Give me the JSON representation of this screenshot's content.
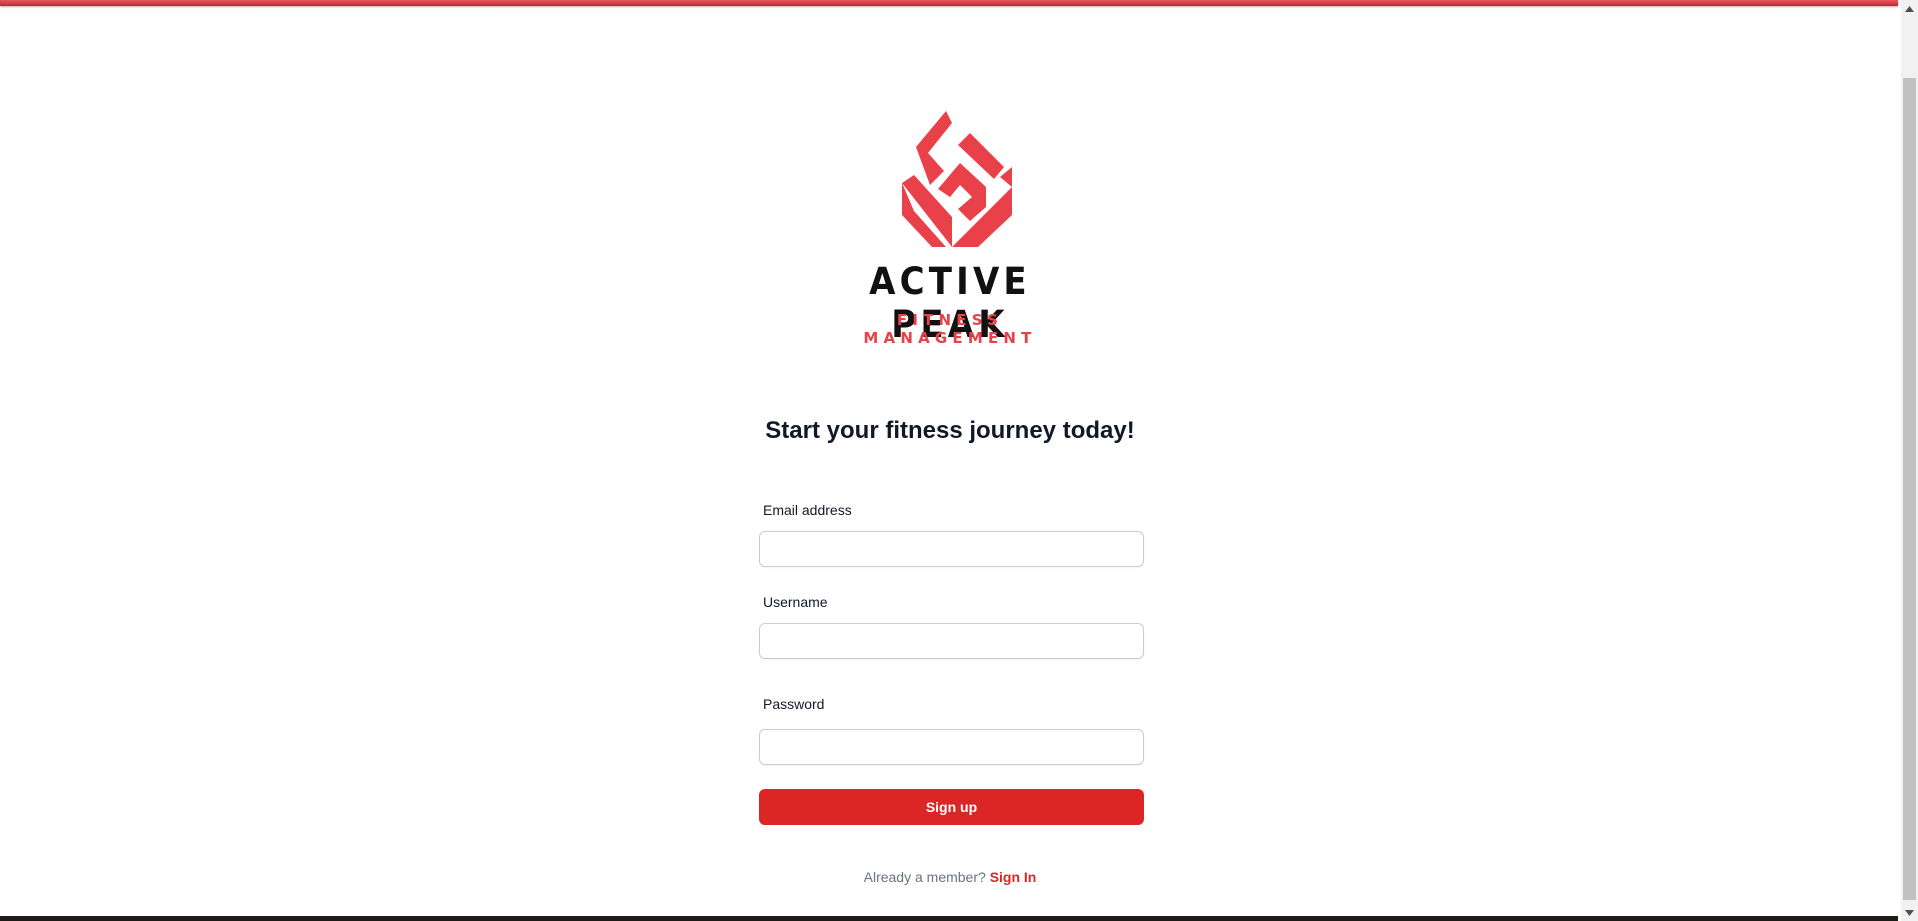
{
  "brand": {
    "name": "ACTIVE PEAK",
    "tagline": "FITNESS MANAGEMENT",
    "accent_color": "#e8414a"
  },
  "heading": "Start your fitness journey today!",
  "form": {
    "email": {
      "label": "Email address",
      "value": "",
      "placeholder": ""
    },
    "username": {
      "label": "Username",
      "value": "",
      "placeholder": ""
    },
    "password": {
      "label": "Password",
      "value": "",
      "placeholder": ""
    },
    "submit_label": "Sign up",
    "button_color": "#dc2626"
  },
  "footer": {
    "prompt": "Already a member?",
    "link_label": "Sign In"
  },
  "icons": {
    "logo": "active-peak-logo-icon",
    "scroll_up": "scroll-up-arrow-icon",
    "scroll_down": "scroll-down-arrow-icon"
  }
}
